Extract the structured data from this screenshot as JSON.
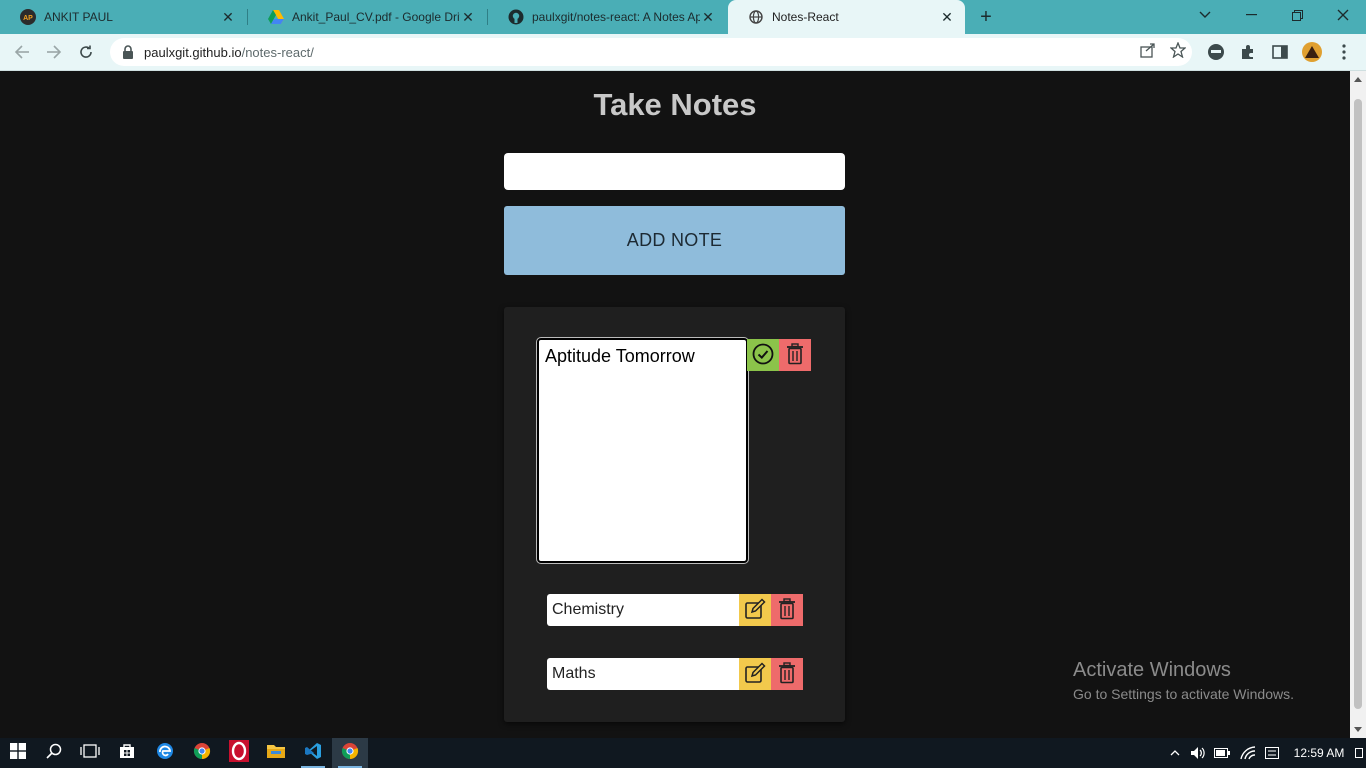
{
  "browser": {
    "tabs": [
      {
        "title": "ANKIT PAUL",
        "favicon": "ap-logo-icon",
        "active": false
      },
      {
        "title": "Ankit_Paul_CV.pdf - Google Drive",
        "favicon": "google-drive-icon",
        "active": false
      },
      {
        "title": "paulxgit/notes-react: A Notes Ap",
        "favicon": "github-icon",
        "active": false
      },
      {
        "title": "Notes-React",
        "favicon": "globe-icon",
        "active": true
      }
    ],
    "url_host": "paulxgit.github.io",
    "url_path": "/notes-react/"
  },
  "app": {
    "title": "Take Notes",
    "input_value": "",
    "add_button_label": "ADD NOTE",
    "editing_note": "Aptitude Tomorrow",
    "notes": [
      "Chemistry",
      "Maths"
    ]
  },
  "watermark": {
    "line1": "Activate Windows",
    "line2": "Go to Settings to activate Windows."
  },
  "taskbar": {
    "clock": "12:59 AM"
  },
  "colors": {
    "tab_strip": "#4aaeb6",
    "page_bg": "#121212",
    "add_button": "#8fbcdb",
    "save_button": "#8bc34a",
    "delete_button": "#ee6b6b",
    "edit_button": "#f2c94c"
  }
}
